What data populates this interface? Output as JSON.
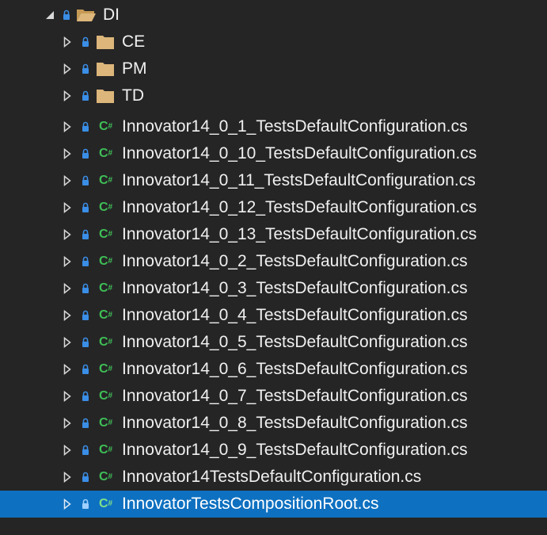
{
  "tree": {
    "root": {
      "label": "DI",
      "icon": "folder-open-icon",
      "expanded": true
    },
    "folders": [
      {
        "label": "CE",
        "icon": "folder-icon"
      },
      {
        "label": "PM",
        "icon": "folder-icon"
      },
      {
        "label": "TD",
        "icon": "folder-icon"
      }
    ],
    "files": [
      {
        "label": "Innovator14_0_1_TestsDefaultConfiguration.cs",
        "icon": "csharp-file-icon"
      },
      {
        "label": "Innovator14_0_10_TestsDefaultConfiguration.cs",
        "icon": "csharp-file-icon"
      },
      {
        "label": "Innovator14_0_11_TestsDefaultConfiguration.cs",
        "icon": "csharp-file-icon"
      },
      {
        "label": "Innovator14_0_12_TestsDefaultConfiguration.cs",
        "icon": "csharp-file-icon"
      },
      {
        "label": "Innovator14_0_13_TestsDefaultConfiguration.cs",
        "icon": "csharp-file-icon"
      },
      {
        "label": "Innovator14_0_2_TestsDefaultConfiguration.cs",
        "icon": "csharp-file-icon"
      },
      {
        "label": "Innovator14_0_3_TestsDefaultConfiguration.cs",
        "icon": "csharp-file-icon"
      },
      {
        "label": "Innovator14_0_4_TestsDefaultConfiguration.cs",
        "icon": "csharp-file-icon"
      },
      {
        "label": "Innovator14_0_5_TestsDefaultConfiguration.cs",
        "icon": "csharp-file-icon"
      },
      {
        "label": "Innovator14_0_6_TestsDefaultConfiguration.cs",
        "icon": "csharp-file-icon"
      },
      {
        "label": "Innovator14_0_7_TestsDefaultConfiguration.cs",
        "icon": "csharp-file-icon"
      },
      {
        "label": "Innovator14_0_8_TestsDefaultConfiguration.cs",
        "icon": "csharp-file-icon"
      },
      {
        "label": "Innovator14_0_9_TestsDefaultConfiguration.cs",
        "icon": "csharp-file-icon"
      },
      {
        "label": "Innovator14TestsDefaultConfiguration.cs",
        "icon": "csharp-file-icon"
      },
      {
        "label": "InnovatorTestsCompositionRoot.cs",
        "icon": "csharp-file-icon",
        "selected": true
      }
    ],
    "cs_icon_text": "C",
    "cs_icon_sup": "#",
    "colors": {
      "background": "#252526",
      "selection": "#0e70c0",
      "folder": "#dcb67a",
      "csharp": "#3fbf56",
      "lock": "#3a8ee6",
      "text": "#f0f0f0"
    }
  }
}
